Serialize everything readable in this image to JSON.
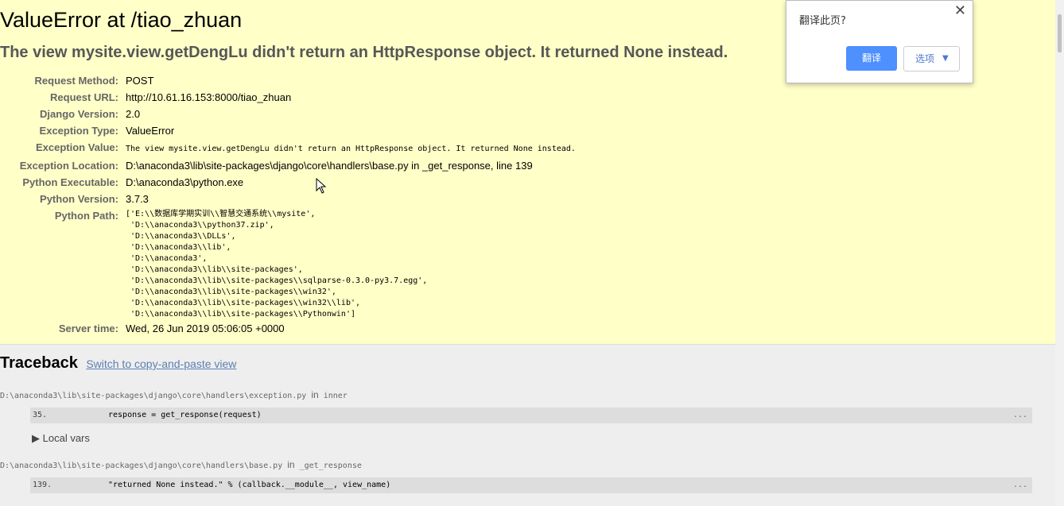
{
  "error": {
    "title": "ValueError at /tiao_zhuan",
    "subtitle": "The view mysite.view.getDengLu didn't return an HttpResponse object. It returned None instead."
  },
  "meta": {
    "request_method_label": "Request Method:",
    "request_method": "POST",
    "request_url_label": "Request URL:",
    "request_url": "http://10.61.16.153:8000/tiao_zhuan",
    "django_version_label": "Django Version:",
    "django_version": "2.0",
    "exception_type_label": "Exception Type:",
    "exception_type": "ValueError",
    "exception_value_label": "Exception Value:",
    "exception_value": "The view mysite.view.getDengLu didn't return an HttpResponse object. It returned None instead.",
    "exception_location_label": "Exception Location:",
    "exception_location": "D:\\anaconda3\\lib\\site-packages\\django\\core\\handlers\\base.py in _get_response, line 139",
    "python_executable_label": "Python Executable:",
    "python_executable": "D:\\anaconda3\\python.exe",
    "python_version_label": "Python Version:",
    "python_version": "3.7.3",
    "python_path_label": "Python Path:",
    "python_path": "['E:\\\\数据库学期实训\\\\智慧交通系统\\\\mysite',\n 'D:\\\\anaconda3\\\\python37.zip',\n 'D:\\\\anaconda3\\\\DLLs',\n 'D:\\\\anaconda3\\\\lib',\n 'D:\\\\anaconda3',\n 'D:\\\\anaconda3\\\\lib\\\\site-packages',\n 'D:\\\\anaconda3\\\\lib\\\\site-packages\\\\sqlparse-0.3.0-py3.7.egg',\n 'D:\\\\anaconda3\\\\lib\\\\site-packages\\\\win32',\n 'D:\\\\anaconda3\\\\lib\\\\site-packages\\\\win32\\\\lib',\n 'D:\\\\anaconda3\\\\lib\\\\site-packages\\\\Pythonwin']",
    "server_time_label": "Server time:",
    "server_time": "Wed, 26 Jun 2019 05:06:05 +0000"
  },
  "traceback": {
    "title": "Traceback",
    "switch_link": "Switch to copy-and-paste view",
    "in_word": "in",
    "local_vars": "Local vars",
    "frames": [
      {
        "file": "D:\\anaconda3\\lib\\site-packages\\django\\core\\handlers\\exception.py",
        "func": "inner",
        "line_no": "35.",
        "code": "response = get_response(request)",
        "dots": "..."
      },
      {
        "file": "D:\\anaconda3\\lib\\site-packages\\django\\core\\handlers\\base.py",
        "func": "_get_response",
        "line_no": "139.",
        "code": "\"returned None instead.\" % (callback.__module__, view_name)",
        "dots": "..."
      }
    ]
  },
  "translate_popup": {
    "title": "翻译此页?",
    "translate_button": "翻译",
    "options_button": "选项",
    "close_icon": "close-icon"
  }
}
